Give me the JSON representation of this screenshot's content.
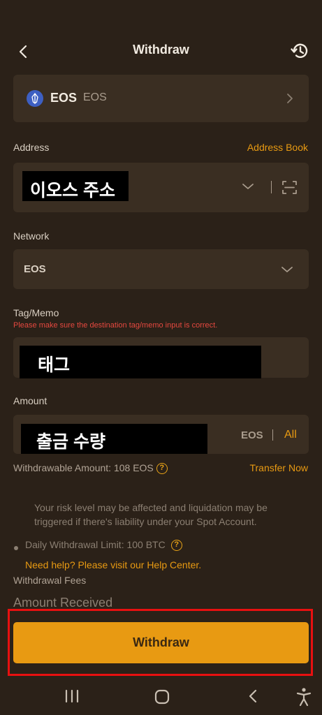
{
  "header": {
    "title": "Withdraw"
  },
  "coin": {
    "symbol": "EOS",
    "name": "EOS"
  },
  "address": {
    "label": "Address",
    "link": "Address Book",
    "value": "이오스 주소"
  },
  "network": {
    "label": "Network",
    "value": "EOS"
  },
  "tag": {
    "label": "Tag/Memo",
    "warning": "Please make sure the destination tag/memo input is correct.",
    "value": "태그"
  },
  "amount": {
    "label": "Amount",
    "value": "출금 수량",
    "unit": "EOS",
    "all_label": "All",
    "withdrawable": "Withdrawable Amount: 108 EOS",
    "transfer_link": "Transfer Now"
  },
  "info": {
    "risk_text": "Your risk level may be affected and liquidation may be triggered if there's liability under your Spot Account.",
    "daily_limit": "Daily Withdrawal Limit: 100 BTC",
    "help_link": "Need help? Please visit our Help Center.",
    "fees_label": "Withdrawal Fees",
    "received_label": "Amount Received"
  },
  "footer": {
    "withdraw_label": "Withdraw"
  },
  "icons": {
    "back": "chevron-left-icon",
    "history": "history-icon",
    "coin": "eos-logo",
    "dropdown": "chevron-down-icon",
    "scan": "scan-icon",
    "help": "question-circle-icon"
  },
  "colors": {
    "background": "#2b2118",
    "card": "#3a2e22",
    "accent": "#e89a12",
    "warning": "#e5483f",
    "highlight_border": "#e81010"
  }
}
